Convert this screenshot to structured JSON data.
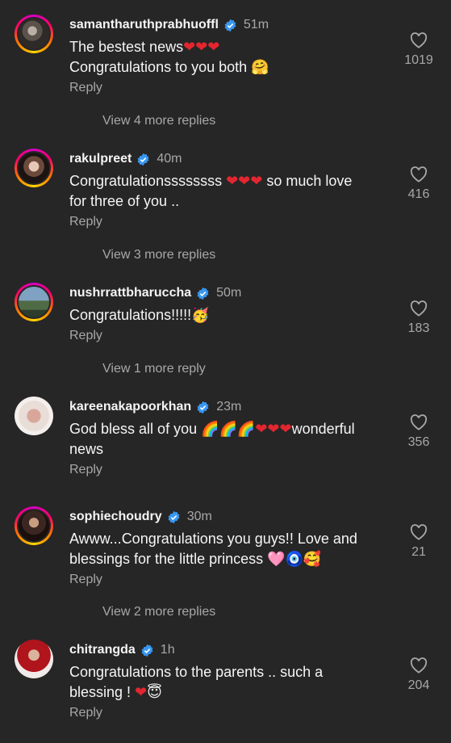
{
  "comments": [
    {
      "username": "samantharuthprabhuoffl",
      "time": "51m",
      "text": "The bestest news❤️❤️❤️\nCongratulations to you both 🤗",
      "reply": "Reply",
      "likes": "1019",
      "more": "View 4 more replies"
    },
    {
      "username": "rakulpreet",
      "time": "40m",
      "text": "Congratulationssssssss ❤️❤️❤️ so much love\nfor three of you ..",
      "reply": "Reply",
      "likes": "416",
      "more": "View 3 more replies"
    },
    {
      "username": "nushrrattbharuccha",
      "time": "50m",
      "text": "Congratulations!!!!!🥳",
      "reply": "Reply",
      "likes": "183",
      "more": "View 1 more reply"
    },
    {
      "username": "kareenakapoorkhan",
      "time": "23m",
      "text": "God bless all of you 🌈🌈🌈❤️❤️❤️wonderful\nnews",
      "reply": "Reply",
      "likes": "356"
    },
    {
      "username": "sophiechoudry",
      "time": "30m",
      "text": "Awww...Congratulations you guys!! Love and\nblessings for the little princess 🩷🧿🥰",
      "reply": "Reply",
      "likes": "21",
      "more": "View 2 more replies"
    },
    {
      "username": "chitrangda",
      "time": "1h",
      "text": "Congratulations to the parents .. such a\nblessing ! ❤️😇",
      "reply": "Reply",
      "likes": "204"
    }
  ],
  "colors": {
    "background": "#262626",
    "verified": "#3897f0",
    "secondary_text": "#a8a8a8"
  },
  "icons": {
    "verified": "verified-badge-icon",
    "like": "heart-outline-icon"
  }
}
